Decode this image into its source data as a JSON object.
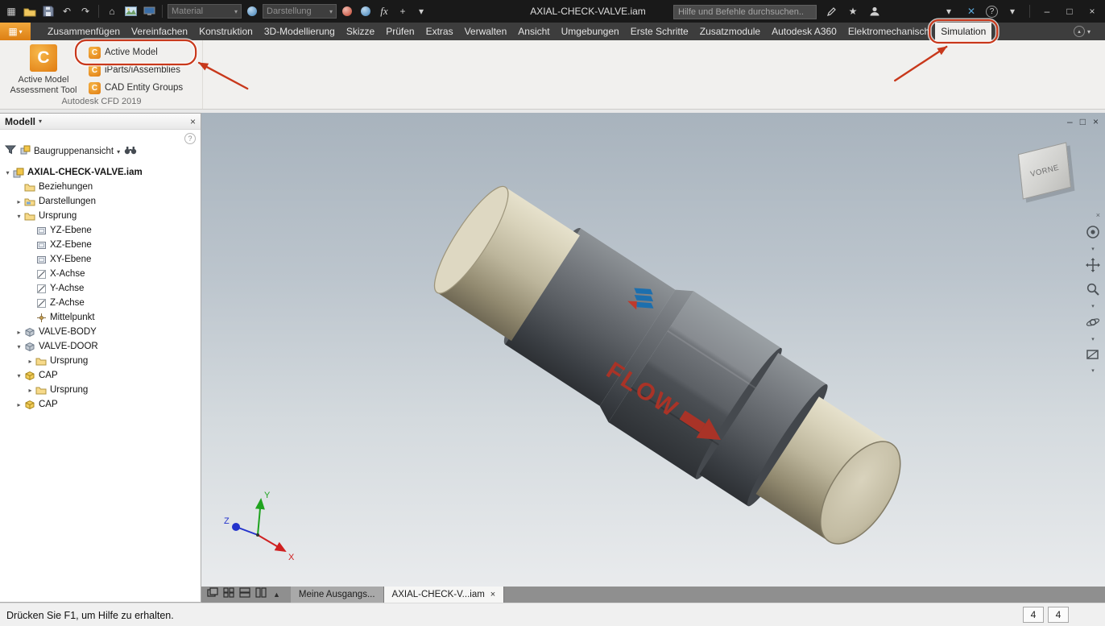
{
  "colors": {
    "annotation": "#c8381b",
    "accent_orange": "#e8821e"
  },
  "titlebar": {
    "title": "AXIAL-CHECK-VALVE.iam",
    "search_placeholder": "Hilfe und Befehle durchsuchen..",
    "material_placeholder": "Material",
    "appearance_placeholder": "Darstellung"
  },
  "icons": {
    "app-menu": "grid",
    "open": "folder",
    "save": "floppy",
    "undo": "↶",
    "redo": "↷",
    "home": "⌂",
    "render": "picture",
    "screen": "monitor",
    "favorites": "★",
    "sign-in": "person",
    "help": "?",
    "minimize": "–",
    "restore": "□",
    "close": "×",
    "filter": "funnel",
    "find": "binoculars",
    "navigation-wheel": "wheel",
    "pan": "hand",
    "zoom": "magnifier",
    "orbit": "orbit",
    "look-at": "face"
  },
  "ribbon": {
    "tabs": [
      "Zusammenfügen",
      "Vereinfachen",
      "Konstruktion",
      "3D-Modellierung",
      "Skizze",
      "Prüfen",
      "Extras",
      "Verwalten",
      "Ansicht",
      "Umgebungen",
      "Erste Schritte",
      "Zusatzmodule",
      "Autodesk A360",
      "Elektromechanisch",
      "Simulation"
    ],
    "active_tab": "Simulation",
    "panel": {
      "big_button_label_line1": "Active Model",
      "big_button_label_line2": "Assessment Tool",
      "buttons": [
        "Active Model",
        "iParts/iAssemblies",
        "CAD Entity Groups"
      ],
      "group_label": "Autodesk CFD 2019"
    }
  },
  "browser": {
    "title": "Modell",
    "view_mode": "Baugruppenansicht",
    "tree": [
      {
        "label": "AXIAL-CHECK-VALVE.iam",
        "icon": "assembly",
        "depth": 0,
        "exp": "open",
        "bold": true
      },
      {
        "label": "Beziehungen",
        "icon": "folder",
        "depth": 1,
        "exp": "none"
      },
      {
        "label": "Darstellungen",
        "icon": "folder-views",
        "depth": 1,
        "exp": "closed"
      },
      {
        "label": "Ursprung",
        "icon": "folder",
        "depth": 1,
        "exp": "open"
      },
      {
        "label": "YZ-Ebene",
        "icon": "plane",
        "depth": 2,
        "exp": "none"
      },
      {
        "label": "XZ-Ebene",
        "icon": "plane",
        "depth": 2,
        "exp": "none"
      },
      {
        "label": "XY-Ebene",
        "icon": "plane",
        "depth": 2,
        "exp": "none"
      },
      {
        "label": "X-Achse",
        "icon": "axis",
        "depth": 2,
        "exp": "none"
      },
      {
        "label": "Y-Achse",
        "icon": "axis",
        "depth": 2,
        "exp": "none"
      },
      {
        "label": "Z-Achse",
        "icon": "axis",
        "depth": 2,
        "exp": "none"
      },
      {
        "label": "Mittelpunkt",
        "icon": "point",
        "depth": 2,
        "exp": "none"
      },
      {
        "label": "VALVE-BODY",
        "icon": "part-gray",
        "depth": 1,
        "exp": "closed"
      },
      {
        "label": "VALVE-DOOR",
        "icon": "part-gray",
        "depth": 1,
        "exp": "open"
      },
      {
        "label": "Ursprung",
        "icon": "folder",
        "depth": 2,
        "exp": "closed"
      },
      {
        "label": "CAP",
        "icon": "part-yellow",
        "depth": 1,
        "exp": "open"
      },
      {
        "label": "Ursprung",
        "icon": "folder",
        "depth": 2,
        "exp": "closed"
      },
      {
        "label": "CAP",
        "icon": "part-yellow",
        "depth": 1,
        "exp": "closed"
      }
    ]
  },
  "viewport": {
    "viewcube_label": "VORNE",
    "model_flow_label": "FLOW",
    "triad": {
      "x": "X",
      "y": "Y",
      "z": "Z"
    }
  },
  "dock": {
    "tabs": [
      {
        "label": "Meine Ausgangs...",
        "active": false,
        "closable": false
      },
      {
        "label": "AXIAL-CHECK-V...iam",
        "active": true,
        "closable": true
      }
    ]
  },
  "statusbar": {
    "message": "Drücken Sie F1, um Hilfe zu erhalten.",
    "right_values": [
      "4",
      "4"
    ]
  }
}
